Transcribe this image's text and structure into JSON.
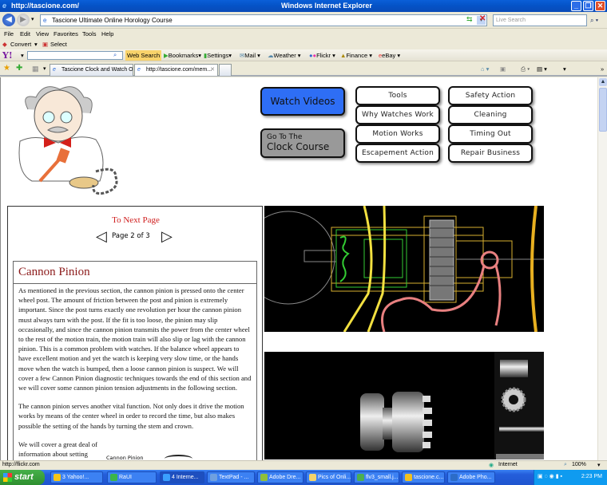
{
  "window": {
    "title_url": "http://tascione.com/",
    "app_title": "Windows Internet Explorer"
  },
  "address_bar": {
    "value": "Tascione Ultimate Online Horology Course",
    "search_placeholder": "Live Search"
  },
  "menu": [
    "File",
    "Edit",
    "View",
    "Favorites",
    "Tools",
    "Help"
  ],
  "convert_bar": {
    "convert": "Convert",
    "select": "Select"
  },
  "yahoo_bar": {
    "logo": "Y!",
    "web_search": "Web Search",
    "items": [
      "Bookmarks",
      "Settings",
      "Mail",
      "Weather",
      "Flickr",
      "Finance",
      "eBay"
    ]
  },
  "tabs": [
    {
      "label": "Tascione Clock and Watch O...",
      "active": false
    },
    {
      "label": "http://tascione.com/mem...",
      "active": true
    }
  ],
  "command_bar": {
    "page": "Page",
    "tools": "Tools"
  },
  "site_nav": {
    "watch_videos": "Watch Videos",
    "clock_course_top": "Go To The",
    "clock_course_bottom": "Clock Course",
    "buttons": [
      "Tools",
      "Safety Action",
      "Why Watches Work",
      "Cleaning",
      "Motion Works",
      "Timing Out",
      "Escapement Action",
      "Repair Business"
    ]
  },
  "article": {
    "next_page": "To Next Page",
    "pager": "Page 2 of 3",
    "title": "Cannon Pinion",
    "paragraphs": [
      "As mentioned in the previous section, the cannon pinion is pressed onto the center wheel post. The amount of friction between the post and pinion is extremely important. Since the post turns exactly one revolution per hour the cannon pinion must always turn with the post. If the fit is too loose, the pinion may slip occasionally, and since the cannon pinion transmits the power from the center wheel to the rest of the motion train, the motion train will also slip or lag with the cannon pinion. This is a common problem with watches. If the balance wheel appears to have excellent motion and yet the watch is keeping very slow time, or the hands move when the watch is bumped, then a loose cannon pinion is suspect. We will cover a few Cannon Pinion diagnostic techniques towards the end of this section and we will cover some cannon pinion tension adjustments in the following section.",
      "The cannon pinion serves another vital function. Not only does it drive the motion works by means of the center wheel in order to record the time, but also makes possible the setting of the hands by turning the stem and crown.",
      "We will cover a great deal of information about setting"
    ],
    "figure_caption": "Cannon Pinion"
  },
  "status_bar": {
    "url": "http://flickr.com",
    "zone": "Internet",
    "zoom": "100%"
  },
  "taskbar": {
    "start": "start",
    "items": [
      {
        "label": "3 Yahoo!...",
        "color": "#f5c518"
      },
      {
        "label": "RaUI",
        "color": "#3bb54a"
      },
      {
        "label": "4 Interne...",
        "color": "#3aa0ff",
        "active": true
      },
      {
        "label": "TextPad - ...",
        "color": "#6fa0e0"
      },
      {
        "label": "Adobe Dre...",
        "color": "#8fbf3a"
      },
      {
        "label": "Pics of Onli...",
        "color": "#f3d36a"
      },
      {
        "label": "flv3_small.j...",
        "color": "#4caf50"
      },
      {
        "label": "tascione.c...",
        "color": "#f0c020"
      },
      {
        "label": "Adobe Pho...",
        "color": "#2c6cc8"
      }
    ],
    "clock": "2:23 PM"
  }
}
